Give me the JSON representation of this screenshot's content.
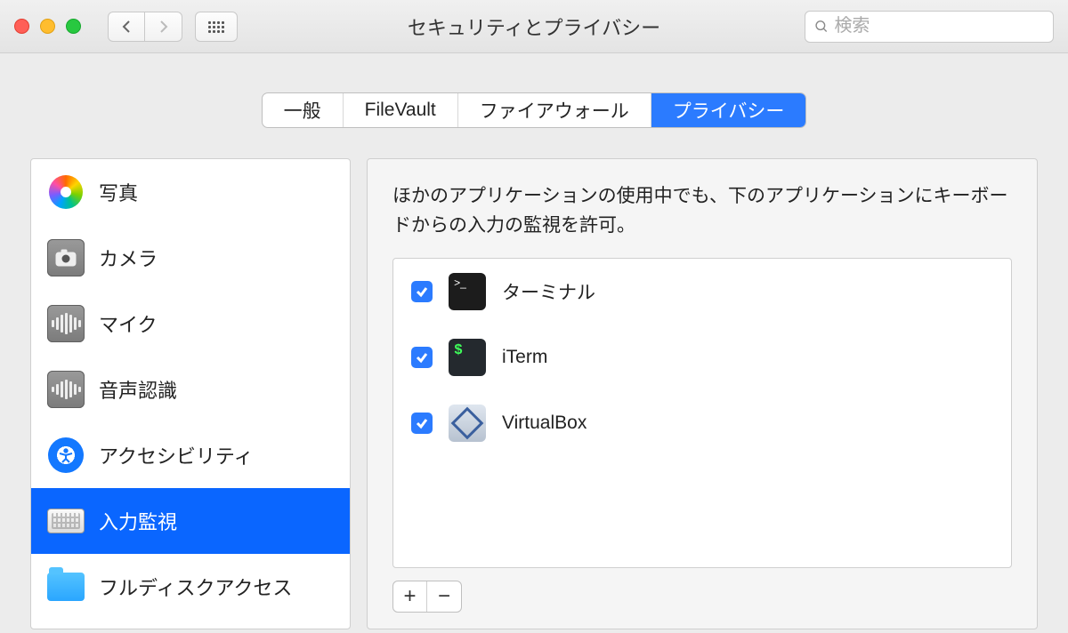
{
  "window": {
    "title": "セキュリティとプライバシー",
    "search_placeholder": "検索"
  },
  "tabs": [
    {
      "label": "一般",
      "active": false
    },
    {
      "label": "FileVault",
      "active": false
    },
    {
      "label": "ファイアウォール",
      "active": false
    },
    {
      "label": "プライバシー",
      "active": true
    }
  ],
  "sidebar": {
    "items": [
      {
        "label": "写真",
        "icon": "photos",
        "selected": false
      },
      {
        "label": "カメラ",
        "icon": "camera",
        "selected": false
      },
      {
        "label": "マイク",
        "icon": "mic",
        "selected": false
      },
      {
        "label": "音声認識",
        "icon": "speech",
        "selected": false
      },
      {
        "label": "アクセシビリティ",
        "icon": "accessibility",
        "selected": false
      },
      {
        "label": "入力監視",
        "icon": "keyboard",
        "selected": true
      },
      {
        "label": "フルディスクアクセス",
        "icon": "folder",
        "selected": false
      }
    ]
  },
  "pane": {
    "description": "ほかのアプリケーションの使用中でも、下のアプリケーションにキーボードからの入力の監視を許可。",
    "apps": [
      {
        "name": "ターミナル",
        "icon": "terminal",
        "checked": true
      },
      {
        "name": "iTerm",
        "icon": "iterm",
        "checked": true
      },
      {
        "name": "VirtualBox",
        "icon": "virtualbox",
        "checked": true
      }
    ],
    "add_label": "+",
    "remove_label": "−"
  }
}
